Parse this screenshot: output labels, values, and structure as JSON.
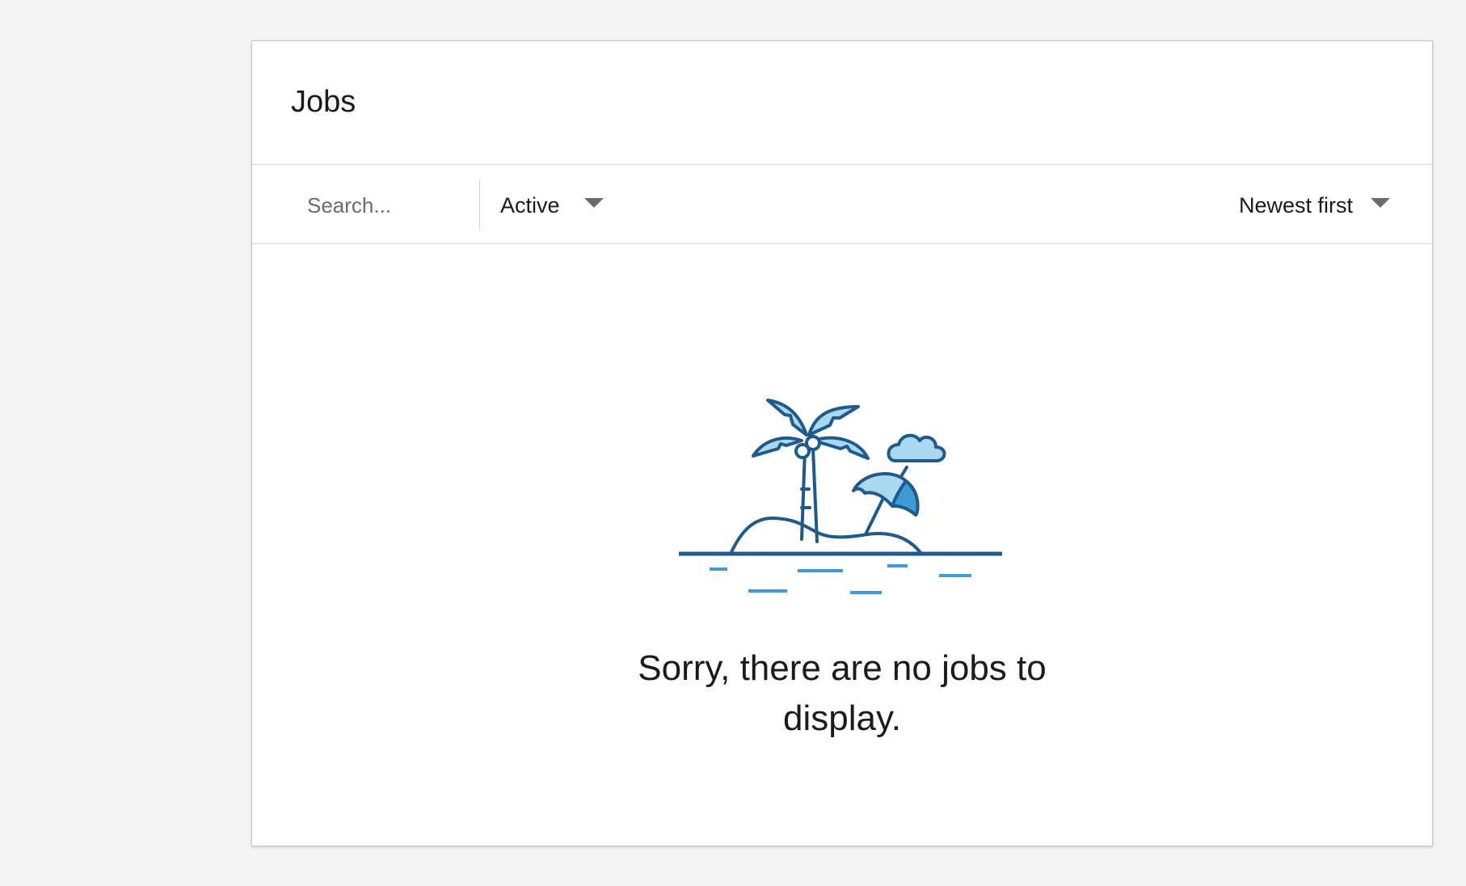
{
  "jobs_panel": {
    "title": "Jobs"
  },
  "toolbar": {
    "search_placeholder": "Search...",
    "search_value": "",
    "status_filter": {
      "selected": "Active"
    },
    "sort": {
      "selected": "Newest first"
    }
  },
  "empty_state": {
    "message": "Sorry, there are no jobs to display.",
    "illustration": "island-palm-tree-icon"
  },
  "colors": {
    "background": "#f4f4f4",
    "card": "#ffffff",
    "text": "#1b1b1b",
    "placeholder": "#6b6b6b",
    "illustration_stroke": "#1f5a8c",
    "illustration_fill": "#a9d8f0",
    "water": "#3f9ad6"
  }
}
